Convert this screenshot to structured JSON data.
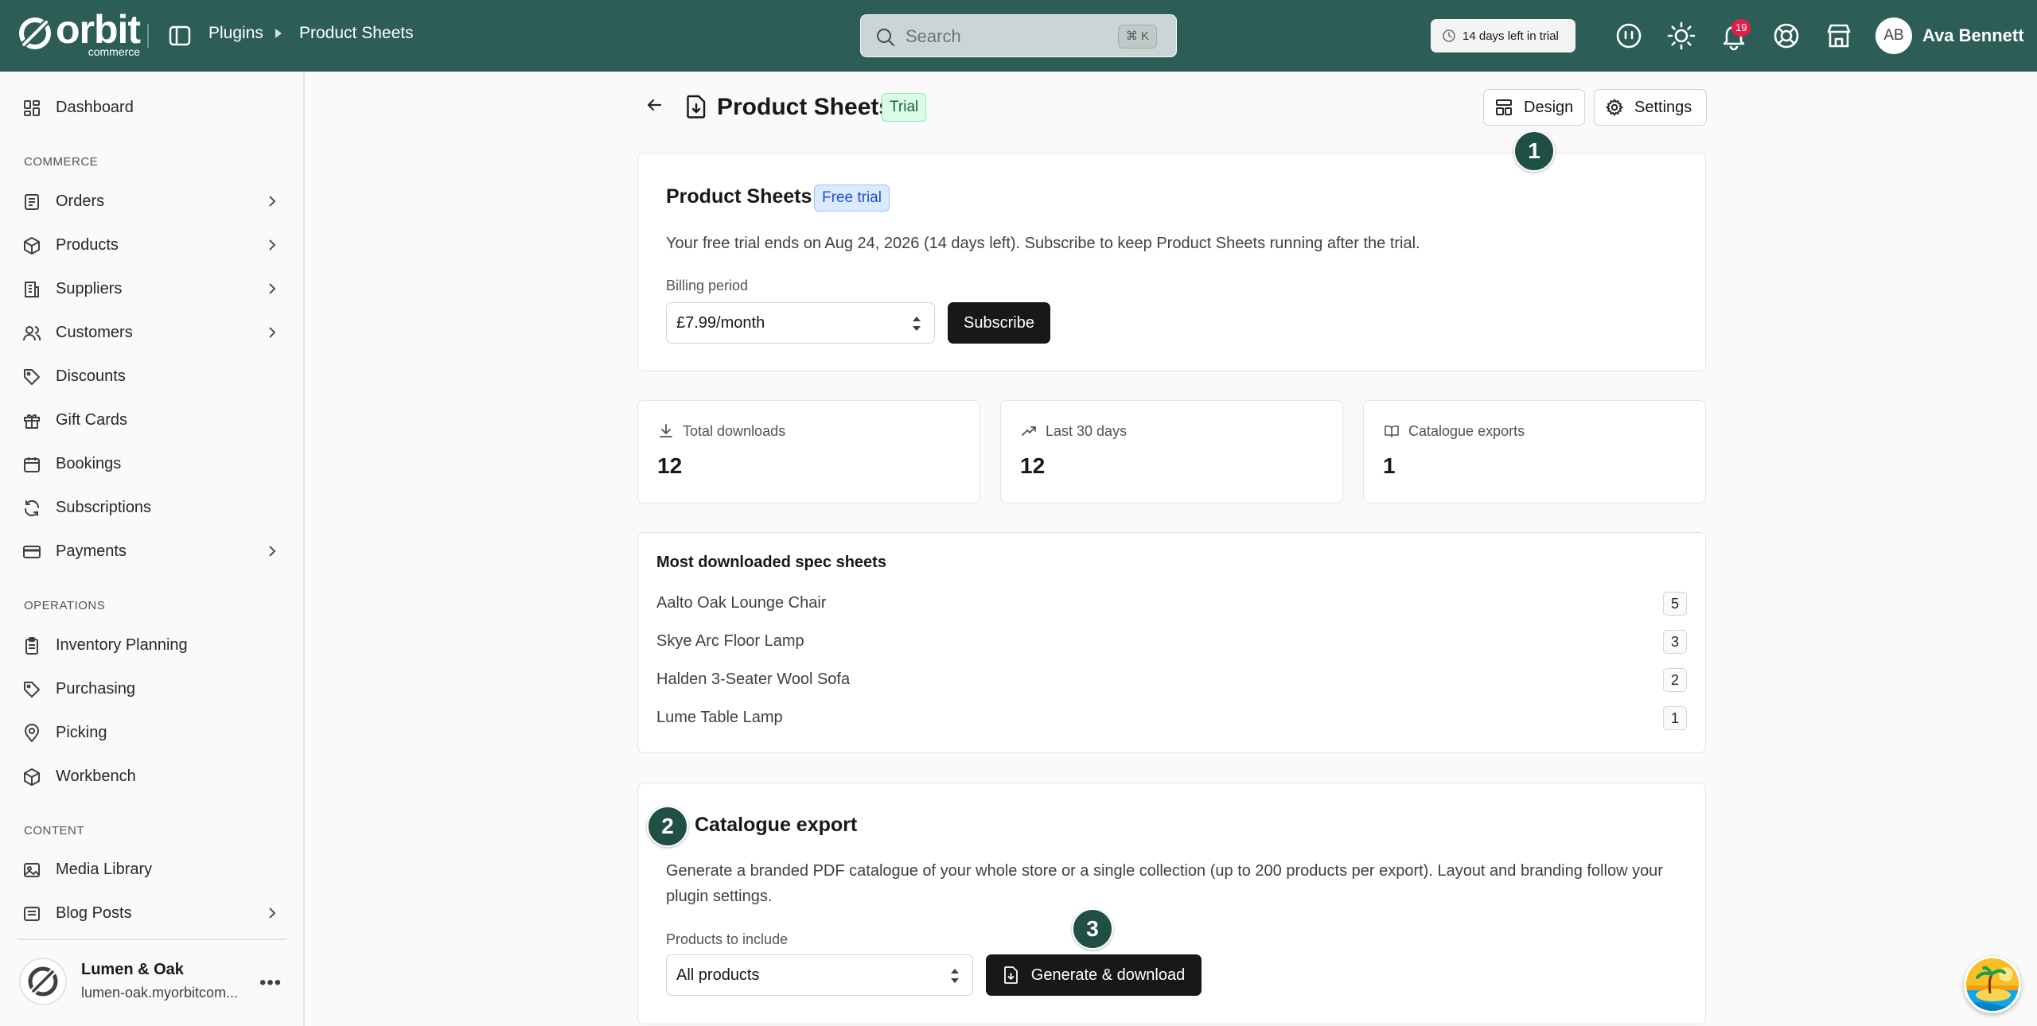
{
  "topbar": {
    "logo_word": "orbit",
    "logo_sub": "commerce",
    "breadcrumb": [
      "Plugins",
      "Product Sheets"
    ],
    "search": {
      "placeholder": "Search",
      "shortcut": "⌘ K"
    },
    "trial_pill": "14 days left in trial",
    "notification_count": "19",
    "user": {
      "initials": "AB",
      "name": "Ava Bennett"
    }
  },
  "sidebar": {
    "dashboard": "Dashboard",
    "sections": {
      "commerce": "COMMERCE",
      "operations": "OPERATIONS",
      "content": "CONTENT"
    },
    "commerce_items": [
      {
        "label": "Orders",
        "icon": "orders-icon",
        "has_children": true
      },
      {
        "label": "Products",
        "icon": "box-icon",
        "has_children": true
      },
      {
        "label": "Suppliers",
        "icon": "building-icon",
        "has_children": true
      },
      {
        "label": "Customers",
        "icon": "users-icon",
        "has_children": true
      },
      {
        "label": "Discounts",
        "icon": "tag-icon",
        "has_children": false
      },
      {
        "label": "Gift Cards",
        "icon": "gift-icon",
        "has_children": false
      },
      {
        "label": "Bookings",
        "icon": "calendar-icon",
        "has_children": false
      },
      {
        "label": "Subscriptions",
        "icon": "refresh-icon",
        "has_children": false
      },
      {
        "label": "Payments",
        "icon": "card-icon",
        "has_children": true
      }
    ],
    "operations_items": [
      {
        "label": "Inventory Planning",
        "icon": "clipboard-icon"
      },
      {
        "label": "Purchasing",
        "icon": "tag-icon"
      },
      {
        "label": "Picking",
        "icon": "pin-icon"
      },
      {
        "label": "Workbench",
        "icon": "cube-icon"
      }
    ],
    "content_items": [
      {
        "label": "Media Library",
        "icon": "image-icon",
        "has_children": false
      },
      {
        "label": "Blog Posts",
        "icon": "news-icon",
        "has_children": true
      }
    ],
    "store": {
      "name": "Lumen & Oak",
      "url": "lumen-oak.myorbitcom..."
    }
  },
  "page": {
    "title": "Product Sheets",
    "status_badge": "Trial",
    "design_label": "Design",
    "settings_label": "Settings"
  },
  "subscription": {
    "title": "Product Sheets",
    "badge": "Free trial",
    "message": "Your free trial ends on Aug 24, 2026 (14 days left). Subscribe to keep Product Sheets running after the trial.",
    "billing_label": "Billing period",
    "billing_value": "£7.99/month",
    "subscribe_label": "Subscribe"
  },
  "stats": [
    {
      "label": "Total downloads",
      "value": "12",
      "icon": "download-icon"
    },
    {
      "label": "Last 30 days",
      "value": "12",
      "icon": "trending-up-icon"
    },
    {
      "label": "Catalogue exports",
      "value": "1",
      "icon": "book-icon"
    }
  ],
  "downloads": {
    "title": "Most downloaded spec sheets",
    "items": [
      {
        "name": "Aalto Oak Lounge Chair",
        "count": "5"
      },
      {
        "name": "Skye Arc Floor Lamp",
        "count": "3"
      },
      {
        "name": "Halden 3-Seater Wool Sofa",
        "count": "2"
      },
      {
        "name": "Lume Table Lamp",
        "count": "1"
      }
    ]
  },
  "catalogue": {
    "title": "Catalogue export",
    "description_line1": "Generate a branded PDF catalogue of your whole store or a single collection (up to 200 products per export). Layout and branding follow your",
    "description_line2": "plugin settings.",
    "products_label": "Products to include",
    "products_value": "All products",
    "generate_label": "Generate & download"
  },
  "markers": [
    "1",
    "2",
    "3"
  ],
  "colors": {
    "topbar": "#2c5d57",
    "accent_dark": "#18181b",
    "marker": "#1f4f45"
  }
}
